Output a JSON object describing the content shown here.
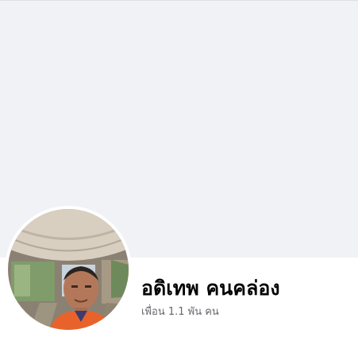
{
  "profile": {
    "name": "อดิเทพ คนคล่อง",
    "friends_count": "เพื่อน 1.1 พัน คน"
  },
  "colors": {
    "cover_background": "#f0f2f5",
    "name_text": "#050505",
    "secondary_text": "#65676b",
    "avatar_border": "#ffffff"
  }
}
